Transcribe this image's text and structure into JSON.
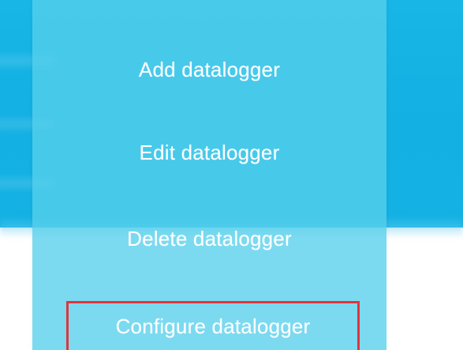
{
  "menu": {
    "items": [
      {
        "label": "Add datalogger"
      },
      {
        "label": "Edit datalogger"
      },
      {
        "label": "Delete datalogger"
      },
      {
        "label": "Configure datalogger",
        "highlighted": true
      }
    ]
  },
  "colors": {
    "header_background": "#14b2e4",
    "menu_background": "#56cfec",
    "menu_text": "#ffffff",
    "highlight_border": "#e0353b"
  }
}
